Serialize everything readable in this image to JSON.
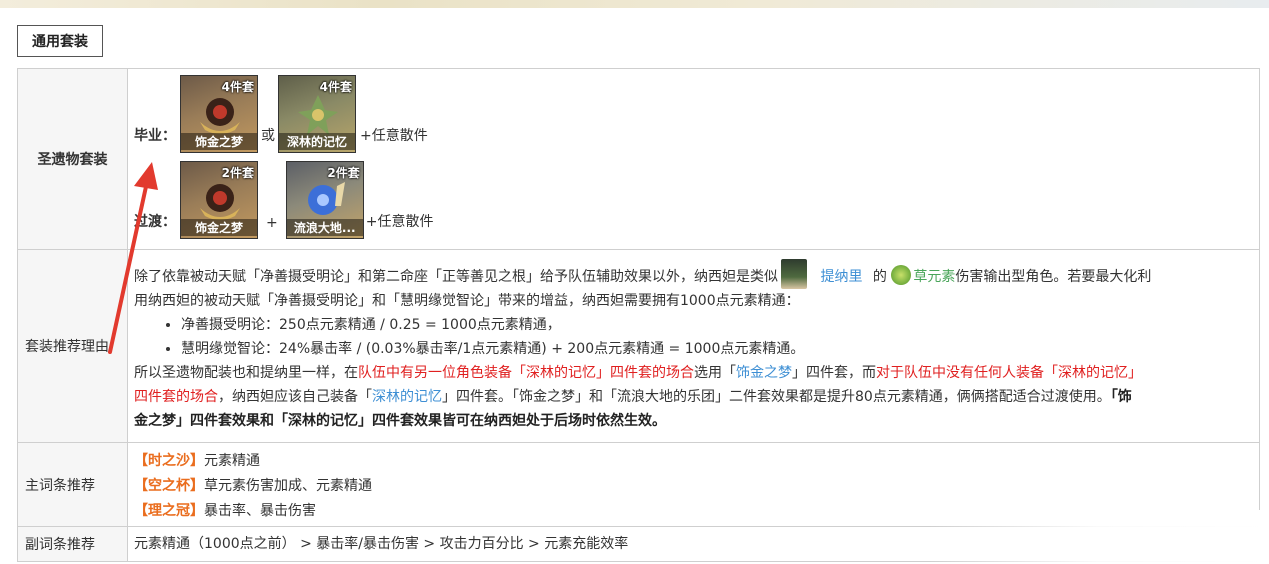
{
  "tab": {
    "label": "通用套装"
  },
  "rows": {
    "artifact_set": {
      "header": "圣遗物套装",
      "best_label": "毕业：",
      "best_icon1": {
        "badge": "4件套",
        "name": "饰金之梦"
      },
      "best_or": "或",
      "best_icon2": {
        "badge": "4件套",
        "name": "深林的记忆"
      },
      "best_tail": "+任意散件",
      "transition_label": "过渡：",
      "trans_icon1": {
        "badge": "2件套",
        "name": "饰金之梦"
      },
      "trans_plus": "+",
      "trans_icon2": {
        "badge": "2件套",
        "name": "流浪大地..."
      },
      "trans_tail": "+任意散件"
    },
    "reason": {
      "header": "套装推荐理由",
      "p1_a": "除了依靠被动天赋「净善摄受明论」和第二命座「正等善见之根」给予队伍辅助效果以外，纳西妲是类似",
      "p1_tighnari": "提纳里",
      "p1_de": "的",
      "p1_dendro": "草元素",
      "p1_b": "伤害输出型角色。若要最大化利",
      "p2": "用纳西妲的被动天赋「净善摄受明论」和「慧明缘觉智论」带来的增益，纳西妲需要拥有1000点元素精通：",
      "bullet1": "净善摄受明论：250点元素精通 / 0.25 = 1000点元素精通，",
      "bullet2": "慧明缘觉智论：24%暴击率 / (0.03%暴击率/1点元素精通) + 200点元素精通 = 1000点元素精通。",
      "p3_a": "所以圣遗物配装也和提纳里一样，在",
      "p3_red1": "队伍中有另一位角色装备「深林的记忆」四件套的场合",
      "p3_b": "选用「",
      "p3_blue1": "饰金之梦",
      "p3_c": "」四件套，而",
      "p3_red2a": "对于队伍中没有任何人装备「深林的记忆」",
      "p4_red2b": "四件套的场合",
      "p4_a": "，纳西妲应该自己装备「",
      "p4_blue2": "深林的记忆",
      "p4_b": "」四件套。「饰金之梦」和「流浪大地的乐团」二件套效果都是提升80点元素精通，俩俩搭配适合过渡使用。",
      "p4_bold1": "「饰",
      "p5_bold": "金之梦」四件套效果和「深林的记忆」四件套效果皆可在纳西妲处于后场时依然生效。"
    },
    "main_stats": {
      "header": "主词条推荐",
      "sands_tag": "【时之沙】",
      "sands_val": "元素精通",
      "goblet_tag": "【空之杯】",
      "goblet_val": "草元素伤害加成、元素精通",
      "circlet_tag": "【理之冠】",
      "circlet_val": "暴击率、暴击伤害"
    },
    "sub_stats": {
      "header": "副词条推荐",
      "value": "元素精通（1000点之前） > 暴击率/暴击伤害 > 攻击力百分比 > 元素充能效率"
    }
  },
  "colors": {
    "red": "#e02020",
    "blue": "#3e8fd4",
    "green": "#4aa55a",
    "orange": "#ea6d1e",
    "arrow": "#e23a2e"
  },
  "icons": [
    "avatar-tighnari-icon",
    "dendro-element-icon",
    "arrow-annotation-icon"
  ]
}
